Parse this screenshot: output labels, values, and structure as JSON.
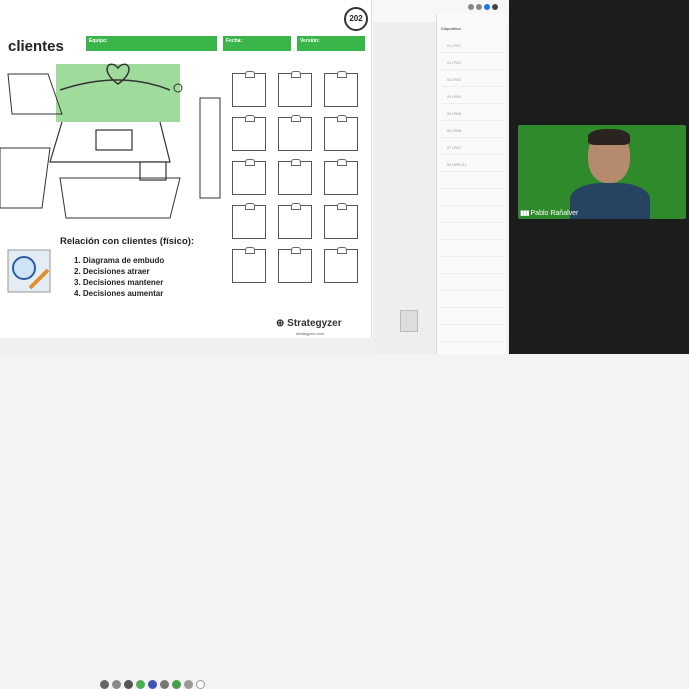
{
  "slide": {
    "title": "clientes",
    "badge": "202",
    "header_fields": [
      "Equipo:",
      "Fecha:",
      "Versión:"
    ],
    "relation_title": "Relación con clientes (físico):",
    "relation_items": [
      "1. Diagrama de embudo",
      "2. Decisiones atraer",
      "3. Decisiones mantener",
      "4. Decisiones aumentar"
    ],
    "logo": "Strategyzer",
    "logo_sub": "strategyzer.com"
  },
  "panel": {
    "title": "Diapositiva",
    "items": [
      {
        "label": "01 LPI01"
      },
      {
        "label": "02 LPI02"
      },
      {
        "label": "03 LPI03"
      },
      {
        "label": "04 LPI04"
      },
      {
        "label": "05 LPI05"
      },
      {
        "label": "06 LPI06"
      },
      {
        "label": "07 LPI07"
      },
      {
        "label": "08 LMP4 8.1"
      }
    ]
  },
  "video": {
    "participant_name": "Pablo Rañalver"
  },
  "colors": {
    "accent_green": "#39b54a",
    "camera_bg": "#2e8a2a",
    "panel_red": "#c62828"
  }
}
